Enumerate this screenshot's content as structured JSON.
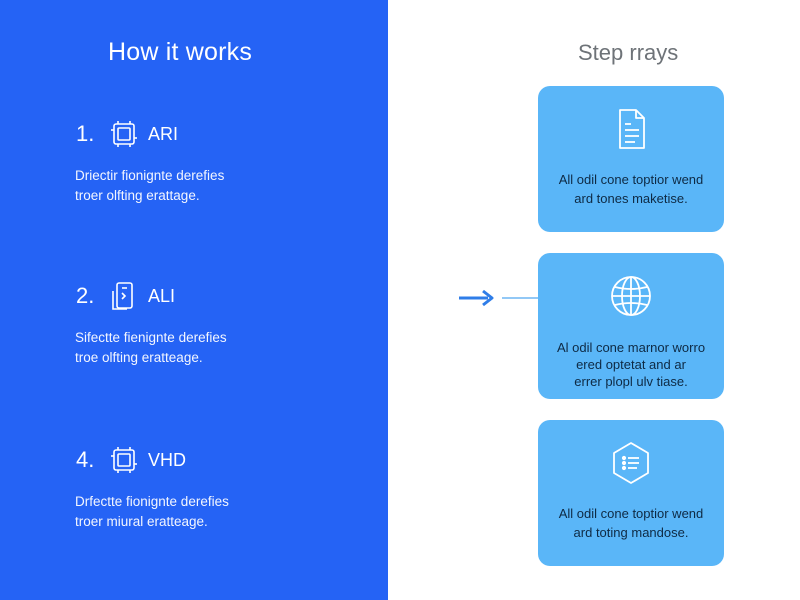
{
  "left": {
    "title": "How it works",
    "steps": [
      {
        "number": "1.",
        "icon": "frame-icon",
        "label": "ARI",
        "desc_line1": "Driectir fionignte derefies",
        "desc_line2": "troer olfting erattage."
      },
      {
        "number": "2.",
        "icon": "phone-icon",
        "label": "ALI",
        "desc_line1": "Sifectte fienignte derefies",
        "desc_line2": "troe olfting eratteage."
      },
      {
        "number": "4.",
        "icon": "frame-icon",
        "label": "VHD",
        "desc_line1": "Drfectte fionignte derefies",
        "desc_line2": "troer miural eratteage."
      }
    ]
  },
  "right": {
    "title": "Step rrays",
    "cards": [
      {
        "icon": "document-icon",
        "line1": "All odil cone toptior wend",
        "line2": "ard tones maketise."
      },
      {
        "icon": "globe-icon",
        "line1": "Al odil cone marnor worro",
        "line2": "ered optetat and ar",
        "line3": "errer plopl ulv tiase."
      },
      {
        "icon": "list-hexagon-icon",
        "line1": "All odil cone toptior wend",
        "line2": "ard toting mandose."
      }
    ]
  },
  "colors": {
    "left_panel": "#2563f5",
    "card_bg": "#5ab6f8",
    "connector": "#2f7de8",
    "right_title": "#6e7378"
  }
}
